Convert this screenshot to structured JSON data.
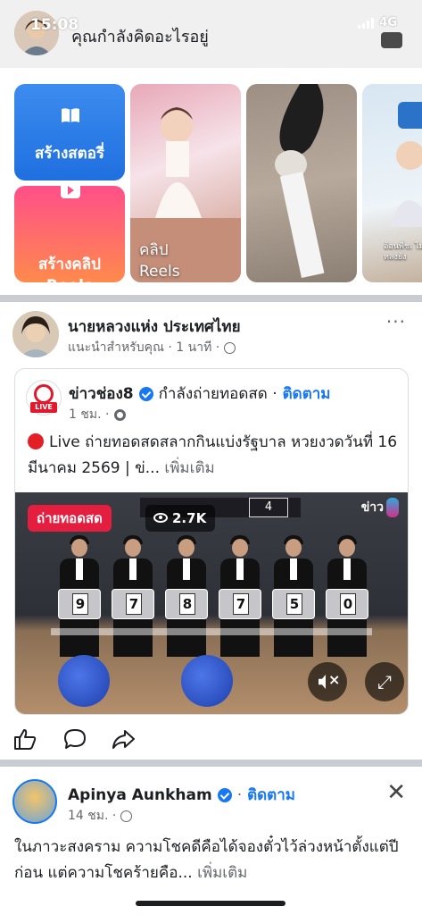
{
  "status_bar": {
    "time": "15:08",
    "network": "4G"
  },
  "composer": {
    "placeholder": "คุณกำลังคิดอะไรอยู่"
  },
  "stories": {
    "create_story_label": "สร้างสตอรี่",
    "create_reel_label": "สร้างคลิป Reels",
    "reels_label": "คลิป Reels",
    "reel3_caption": "อ้อนพี่ชเ ไม่หลงยัง"
  },
  "post1": {
    "author": "นายหลวงแห่ง ประเทศไทย",
    "meta": "แนะนำสำหรับคุณ · 1 นาที ·",
    "more": "···",
    "shared": {
      "page_name": "ข่าวช่อง8",
      "status": "กำลังถ่ายทอดสด ·",
      "follow": "ติดตาม",
      "time": "1 ชม. ·",
      "text": "Live ถ่ายทอดสดสลากกินแบ่งรัฐบาล หวยงวดวันที่ 16 มีนาคม 2569 | ข่...",
      "see_more": "เพิ่มเติม",
      "video": {
        "live_badge": "ถ่ายทอดสด",
        "viewers": "2.7K",
        "banner_num": "4",
        "logo_text": "ข่าว",
        "digits": [
          "9",
          "7",
          "8",
          "7",
          "5",
          "0"
        ]
      }
    }
  },
  "post2": {
    "author": "Apinya Aunkham",
    "follow": "ติดตาม",
    "time": "14 ชม. ·",
    "text": "ในภาวะสงคราม ความโชคดีคือได้จองตั๋วไว้ล่วงหน้าตั้งแต่ปีก่อน แต่ความโชคร้ายคือ...",
    "see_more": "เพิ่มเติม"
  },
  "colors": {
    "accent": "#1877f2",
    "live_red": "#e41e3f"
  }
}
